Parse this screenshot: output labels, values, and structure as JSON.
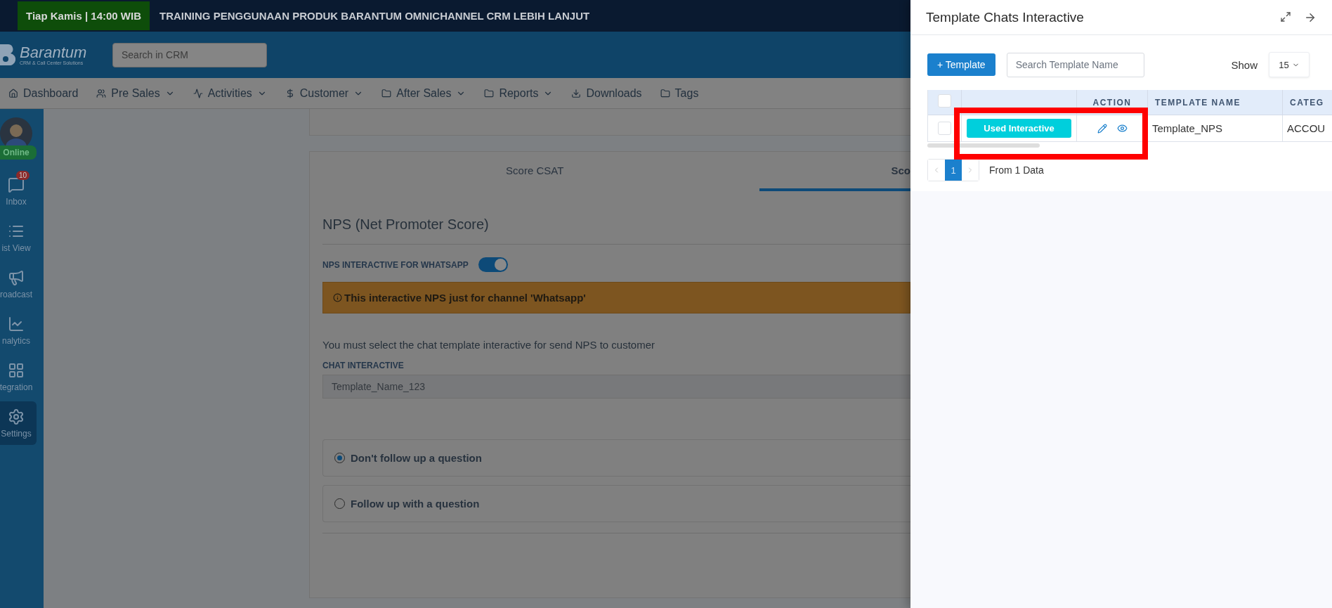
{
  "banner": {
    "badge": "Tiap Kamis | 14:00 WIB",
    "text": "TRAINING PENGGUNAAN PRODUK BARANTUM OMNICHANNEL CRM LEBIH LANJUT"
  },
  "header": {
    "logo_name": "Barantum",
    "logo_tagline": "CRM & Call Center Solutions",
    "search": {
      "placeholder": "Search in CRM"
    }
  },
  "nav": [
    {
      "label": "Dashboard",
      "has_menu": false
    },
    {
      "label": "Pre Sales",
      "has_menu": true
    },
    {
      "label": "Activities",
      "has_menu": true
    },
    {
      "label": "Customer",
      "has_menu": true
    },
    {
      "label": "After Sales",
      "has_menu": true
    },
    {
      "label": "Reports",
      "has_menu": true
    },
    {
      "label": "Downloads",
      "has_menu": false
    },
    {
      "label": "Tags",
      "has_menu": false
    }
  ],
  "sidebar": {
    "status": "Online",
    "items": [
      {
        "label": "Inbox",
        "badge": "10",
        "selected": false
      },
      {
        "label": "ist View",
        "selected": false
      },
      {
        "label": "roadcast",
        "selected": false
      },
      {
        "label": "nalytics",
        "selected": false
      },
      {
        "label": "tegration",
        "selected": false
      },
      {
        "label": "Settings",
        "selected": true
      }
    ]
  },
  "main": {
    "tabs": [
      {
        "label": "Score CSAT",
        "selected": false
      },
      {
        "label": "Sco",
        "selected": true
      }
    ],
    "section_title": "NPS (Net Promoter Score)",
    "toggle": {
      "label": "NPS INTERACTIVE FOR WHATSAPP",
      "on": true
    },
    "alert": "This interactive NPS just for channel 'Whatsapp'",
    "description": "You must select the chat template interactive for send NPS to customer",
    "field": {
      "label": "CHAT INTERACTIVE",
      "value": "Template_Name_123"
    },
    "options": [
      {
        "label": "Don't follow up a question",
        "selected": true
      },
      {
        "label": "Follow up with a question",
        "selected": false
      }
    ]
  },
  "panel": {
    "title": "Template Chats Interactive",
    "add_button": "+ Template",
    "search": {
      "placeholder": "Search Template Name"
    },
    "show_label": "Show",
    "page_size": "15",
    "table": {
      "header_checked": false,
      "columns": [
        "ACTION",
        "TEMPLATE NAME",
        "CATEG"
      ],
      "rows": [
        {
          "checked": false,
          "status": "Used Interactive",
          "template_name": "Template_NPS",
          "category": "ACCOU"
        }
      ]
    },
    "pages": [
      {
        "label": "1",
        "selected": true
      }
    ],
    "summary": "From 1 Data",
    "highlight_frame": true
  }
}
